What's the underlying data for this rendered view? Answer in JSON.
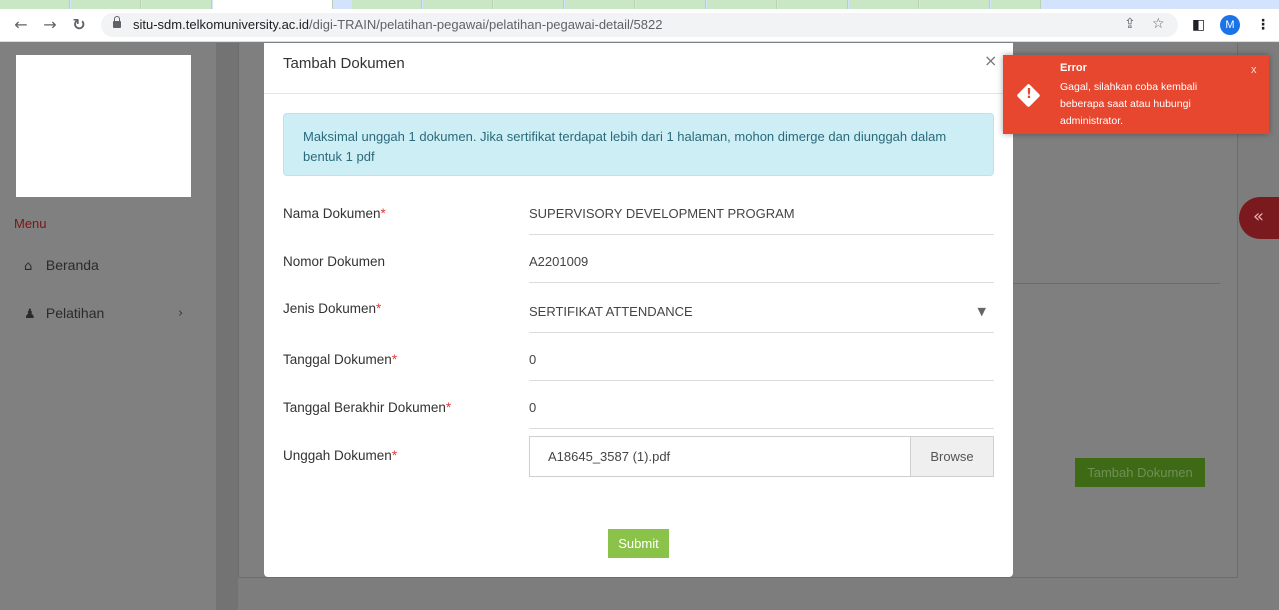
{
  "browser": {
    "url_host": "situ-sdm.telkomuniversity.ac.id",
    "url_path": "/digi-TRAIN/pelatihan-pegawai/pelatihan-pegawai-detail/5822",
    "profile_initial": "M"
  },
  "sidebar": {
    "menu_title": "Menu",
    "items": [
      {
        "label": "Beranda",
        "icon": "home-icon"
      },
      {
        "label": "Pelatihan",
        "icon": "person-icon",
        "has_submenu": true
      }
    ]
  },
  "background": {
    "add_document_button": "Tambah Dokumen"
  },
  "modal": {
    "title": "Tambah Dokumen",
    "close_symbol": "×",
    "info_alert": "Maksimal unggah 1 dokumen. Jika sertifikat terdapat lebih dari 1 halaman, mohon dimerge dan diunggah dalam bentuk 1 pdf",
    "fields": {
      "nama_dokumen": {
        "label": "Nama Dokumen",
        "required": true,
        "value": "SUPERVISORY DEVELOPMENT PROGRAM"
      },
      "nomor_dokumen": {
        "label": "Nomor Dokumen",
        "required": false,
        "value": "A2201009"
      },
      "jenis_dokumen": {
        "label": "Jenis Dokumen",
        "required": true,
        "value": "SERTIFIKAT ATTENDANCE"
      },
      "tanggal_dokumen": {
        "label": "Tanggal Dokumen",
        "required": true,
        "value": "0"
      },
      "tanggal_berakhir": {
        "label": "Tanggal Berakhir Dokumen",
        "required": true,
        "value": "0"
      },
      "unggah_dokumen": {
        "label": "Unggah Dokumen",
        "required": true,
        "file_name": "A18645_3587 (1).pdf",
        "browse_label": "Browse"
      }
    },
    "submit_label": "Submit"
  },
  "toast": {
    "title": "Error",
    "message": "Gagal, silahkan coba kembali beberapa saat atau hubungi administrator.",
    "close_label": "x",
    "color": "#e8472f"
  },
  "colors": {
    "required_star": "#e53935",
    "submit_green": "#8bc34a",
    "alert_bg": "#cdeef4"
  }
}
